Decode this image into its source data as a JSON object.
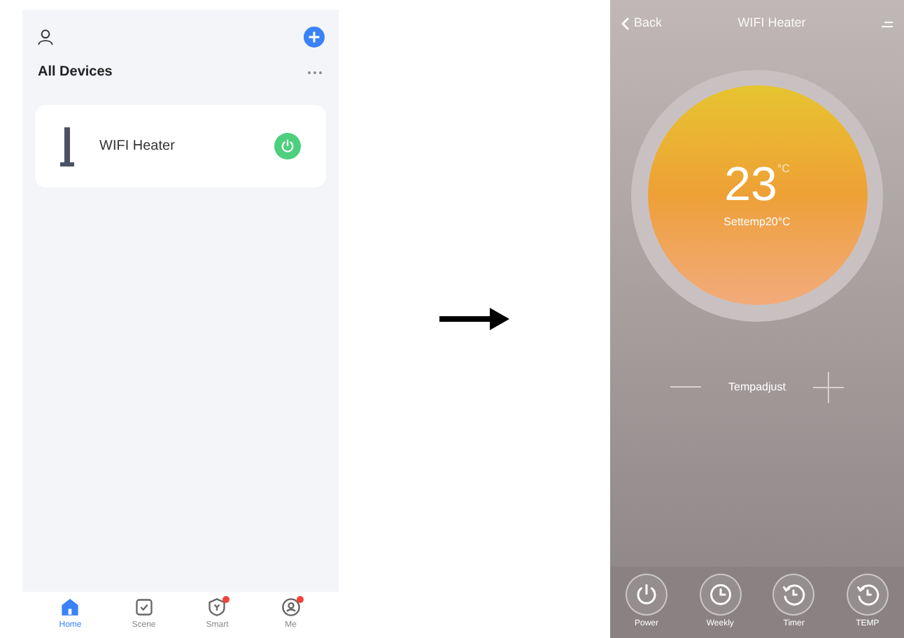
{
  "device_list_screen": {
    "title": "All Devices",
    "devices": [
      {
        "name": "WIFI Heater",
        "on": true
      }
    ],
    "nav": [
      {
        "label": "Home",
        "kind": "home",
        "selected": true,
        "badge": false
      },
      {
        "label": "Scene",
        "kind": "scene",
        "selected": false,
        "badge": false
      },
      {
        "label": "Smart",
        "kind": "smart",
        "selected": false,
        "badge": true
      },
      {
        "label": "Me",
        "kind": "me",
        "selected": false,
        "badge": true
      }
    ]
  },
  "heater_screen": {
    "back": "Back",
    "title": "WIFI Heater",
    "temperature": "23",
    "unit": "°C",
    "set_temp": "Settemp20°C",
    "adjust_label": "Tempadjust",
    "controls": [
      {
        "label": "Power",
        "kind": "power"
      },
      {
        "label": "Weekly",
        "kind": "clock"
      },
      {
        "label": "Timer",
        "kind": "timer"
      },
      {
        "label": "TEMP",
        "kind": "timer"
      }
    ]
  }
}
